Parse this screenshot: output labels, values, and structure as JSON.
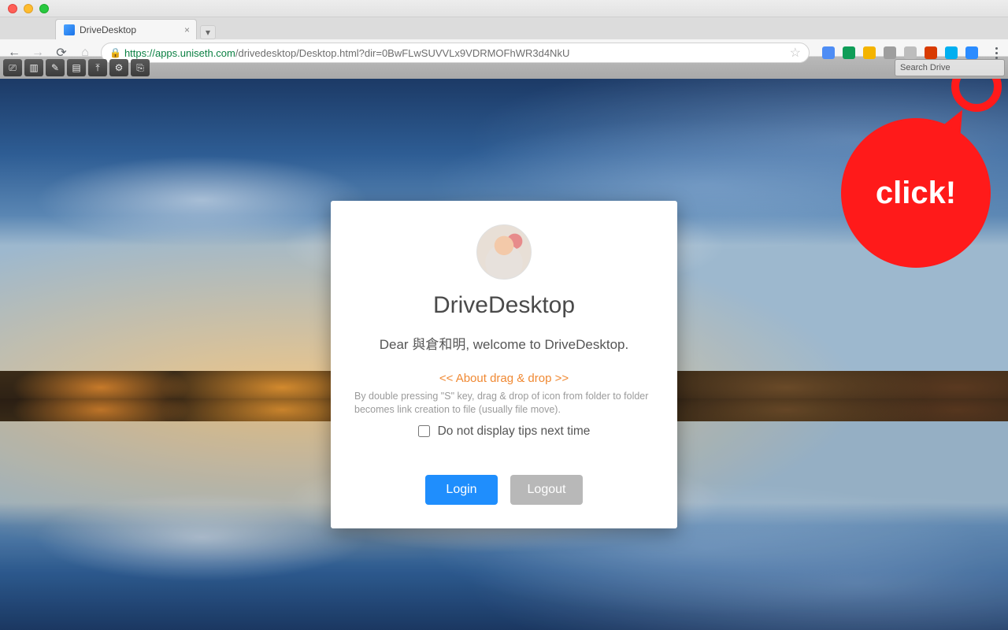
{
  "window": {
    "tab_title": "DriveDesktop",
    "url_host": "https://apps.uniseth.com",
    "url_path": "/drivedesktop/Desktop.html?dir=0BwFLwSUVVLx9VDRMOFhWR3d4NkU"
  },
  "extensions": [
    {
      "name": "translate-icon",
      "color": "#4e8df5"
    },
    {
      "name": "hangouts-icon",
      "color": "#0f9d58"
    },
    {
      "name": "drive-icon",
      "color": "#f4b400"
    },
    {
      "name": "grid-icon",
      "color": "#9e9e9e"
    },
    {
      "name": "circle-icon",
      "color": "#bdbdbd"
    },
    {
      "name": "office-icon",
      "color": "#d83b01"
    },
    {
      "name": "skype-icon",
      "color": "#00aff0"
    },
    {
      "name": "drivedesktop-icon",
      "color": "#2b8cff"
    }
  ],
  "app_toolbar": {
    "buttons": [
      {
        "name": "settings-sliders-icon",
        "glyph": "⎚"
      },
      {
        "name": "chart-icon",
        "glyph": "▥"
      },
      {
        "name": "edit-icon",
        "glyph": "✎"
      },
      {
        "name": "new-file-icon",
        "glyph": "▤"
      },
      {
        "name": "upload-icon",
        "glyph": "⤒"
      },
      {
        "name": "gear-icon",
        "glyph": "⚙"
      },
      {
        "name": "exit-icon",
        "glyph": "⎘"
      }
    ],
    "search_placeholder": "Search Drive"
  },
  "card": {
    "title": "DriveDesktop",
    "greeting": "Dear 與倉和明, welcome to DriveDesktop.",
    "tip_title": "<< About drag & drop >>",
    "tip_body": "By double pressing \"S\" key, drag & drop of icon from folder to folder becomes link creation to file (usually file move).",
    "checkbox_label": "Do not display tips next time",
    "login_label": "Login",
    "logout_label": "Logout"
  },
  "callout": {
    "text": "click!"
  }
}
